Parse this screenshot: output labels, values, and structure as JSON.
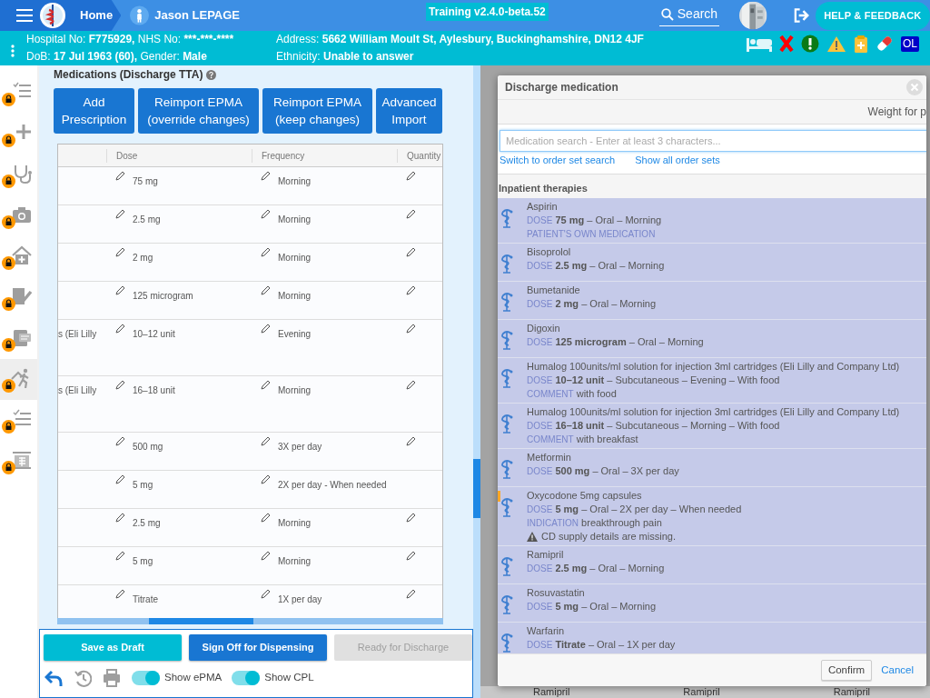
{
  "header": {
    "home": "Home",
    "patient_name": "Jason LEPAGE",
    "build_badge": "Training v2.4.0-beta.52",
    "search": "Search",
    "help": "HELP & FEEDBACK"
  },
  "banner": {
    "left_lines": [
      [
        {
          "label": "Hospital No:",
          "value": "F775929,"
        },
        {
          "label": "NHS No:",
          "value": "***-***-****"
        }
      ],
      [
        {
          "label": "DoB:",
          "value": "17 Jul 1963 (60),"
        },
        {
          "label": "Gender:",
          "value": "Male"
        }
      ]
    ],
    "right_lines": [
      [
        {
          "label": "Address:",
          "value": "5662 William Moult St, Aylesbury, Buckinghamshire, DN12 4JF"
        }
      ],
      [
        {
          "label": "Ethnicity:",
          "value": "Unable to answer"
        }
      ]
    ],
    "alert_badge": "OL"
  },
  "sidebar": {
    "items": [
      {
        "selected": false,
        "locked": true
      },
      {
        "selected": false,
        "locked": true
      },
      {
        "selected": false,
        "locked": true
      },
      {
        "selected": false,
        "locked": true
      },
      {
        "selected": false,
        "locked": true
      },
      {
        "selected": false,
        "locked": true
      },
      {
        "selected": false,
        "locked": true
      },
      {
        "selected": true,
        "locked": true
      },
      {
        "selected": false,
        "locked": true
      },
      {
        "selected": false,
        "locked": true
      }
    ]
  },
  "medications": {
    "title": "Medications (Discharge TTA)",
    "buttons": [
      {
        "lines": [
          "Add",
          "Prescription"
        ]
      },
      {
        "lines": [
          "Reimport EPMA",
          "(override changes)"
        ]
      },
      {
        "lines": [
          "Reimport EPMA",
          "(keep changes)"
        ]
      },
      {
        "lines": [
          "Advanced",
          "Import"
        ]
      }
    ],
    "table": {
      "columns": [
        "Dose",
        "Frequency",
        "Quantity"
      ],
      "rows": [
        {
          "dose": "75 mg",
          "frequency": "Morning",
          "quantity_editable": true
        },
        {
          "dose": "2.5 mg",
          "frequency": "Morning",
          "quantity_editable": true
        },
        {
          "dose": "2 mg",
          "frequency": "Morning",
          "quantity_editable": true
        },
        {
          "dose": "125 microgram",
          "frequency": "Morning",
          "quantity_editable": true
        },
        {
          "medication": "s (Eli Lilly",
          "dose": "10–12 unit",
          "frequency": "Evening",
          "quantity_editable": true
        },
        {
          "medication": "s (Eli Lilly",
          "dose": "16–18 unit",
          "frequency": "Morning",
          "quantity_editable": true
        },
        {
          "dose": "500 mg",
          "frequency": "3X per day",
          "quantity_editable": true
        },
        {
          "dose": "5 mg",
          "frequency": "2X per day - When needed",
          "quantity_editable": false
        },
        {
          "dose": "2.5 mg",
          "frequency": "Morning",
          "quantity_editable": true
        },
        {
          "dose": "5 mg",
          "frequency": "Morning",
          "quantity_editable": true
        },
        {
          "dose": "Titrate",
          "frequency": "1X per day",
          "quantity_editable": true
        }
      ]
    },
    "actions": [
      {
        "label": "Save as Draft",
        "kind": "secondary",
        "disabled": false
      },
      {
        "label": "Sign Off for Dispensing",
        "kind": "primary",
        "disabled": false
      },
      {
        "label": "Ready for Discharge",
        "kind": "primary",
        "disabled": true
      }
    ],
    "tools": [
      {
        "disabled": false
      },
      {
        "disabled": true
      },
      {
        "disabled": true
      }
    ],
    "toggles": [
      {
        "label": "Show ePMA",
        "on": true
      },
      {
        "label": "Show CPL",
        "on": true
      }
    ]
  },
  "background_rows": [
    "Ramipril",
    "Ramipril",
    "Ramipril"
  ],
  "dialog": {
    "title": "Discharge medication",
    "weight_label": "Weight for p",
    "search_placeholder": "Medication search - Enter at least 3 characters...",
    "links": [
      "Switch to order set search",
      "Show all order sets"
    ],
    "section": "Inpatient therapies",
    "items": [
      {
        "name": "Aspirin",
        "selected": true,
        "flagged": false,
        "dose_label": "DOSE",
        "dose": "**75 mg** – Oral – Morning",
        "notes": [
          {
            "kind": "tag",
            "text": "PATIENT'S OWN MEDICATION"
          }
        ]
      },
      {
        "name": "Bisoprolol",
        "selected": true,
        "flagged": false,
        "dose_label": "DOSE",
        "dose": "**2.5 mg** – Oral – Morning"
      },
      {
        "name": "Bumetanide",
        "selected": true,
        "flagged": false,
        "dose_label": "DOSE",
        "dose": "**2 mg** – Oral – Morning"
      },
      {
        "name": "Digoxin",
        "selected": true,
        "flagged": false,
        "dose_label": "DOSE",
        "dose": "**125 microgram** – Oral – Morning"
      },
      {
        "name": "Humalog 100units/ml solution for injection 3ml cartridges (Eli Lilly and Company Ltd)",
        "selected": true,
        "flagged": false,
        "dose_label": "DOSE",
        "dose": "**10–12 unit** – Subcutaneous – Evening – With food",
        "notes": [
          {
            "kind": "labeled",
            "label": "COMMENT",
            "text": "with food"
          }
        ]
      },
      {
        "name": "Humalog 100units/ml solution for injection 3ml cartridges (Eli Lilly and Company Ltd)",
        "selected": true,
        "flagged": false,
        "dose_label": "DOSE",
        "dose": "**16–18 unit** – Subcutaneous – Morning – With food",
        "notes": [
          {
            "kind": "labeled",
            "label": "COMMENT",
            "text": "with breakfast"
          }
        ]
      },
      {
        "name": "Metformin",
        "selected": true,
        "flagged": false,
        "dose_label": "DOSE",
        "dose": "**500 mg** – Oral – 3X per day"
      },
      {
        "name": "Oxycodone 5mg capsules",
        "selected": true,
        "flagged": true,
        "dose_label": "DOSE",
        "dose": "**5 mg** – Oral – 2X per day – When needed",
        "notes": [
          {
            "kind": "labeled",
            "label": "INDICATION",
            "text": "breakthrough pain"
          },
          {
            "kind": "warning",
            "text": "CD supply details are missing."
          }
        ]
      },
      {
        "name": "Ramipril",
        "selected": true,
        "flagged": false,
        "dose_label": "DOSE",
        "dose": "**2.5 mg** – Oral – Morning"
      },
      {
        "name": "Rosuvastatin",
        "selected": true,
        "flagged": false,
        "dose_label": "DOSE",
        "dose": "**5 mg** – Oral – Morning"
      },
      {
        "name": "Warfarin",
        "selected": true,
        "flagged": false,
        "dose_label": "DOSE",
        "dose": "**Titrate** – Oral – 1X per day"
      }
    ],
    "confirm": "Confirm",
    "cancel": "Cancel"
  }
}
